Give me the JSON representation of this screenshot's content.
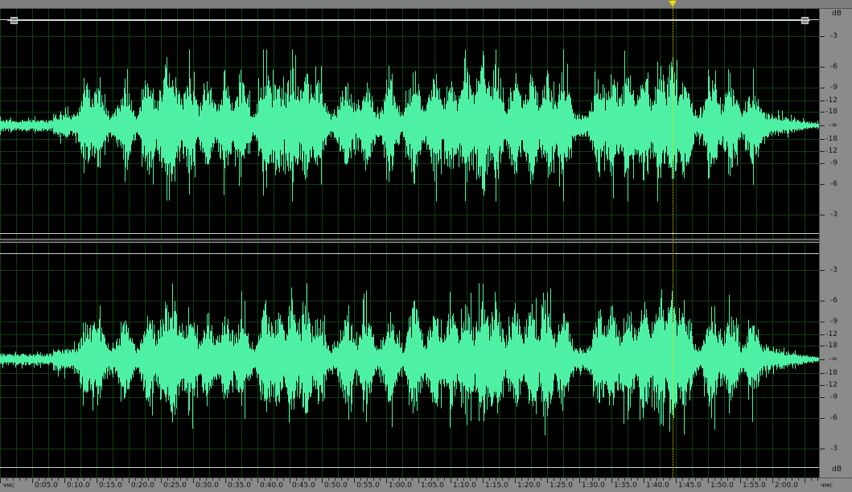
{
  "colors": {
    "waveform": "#4ef0a4",
    "grid": "#0f3d0f",
    "background": "#000000",
    "ruler": "#8b8b8b",
    "playhead": "#e6e600"
  },
  "db_ruler": {
    "unit_top": "dB",
    "unit_bottom": "dB",
    "labels": [
      "-3",
      "-6",
      "-9",
      "-12",
      "-18",
      "-∞",
      "-18",
      "-12",
      "-9",
      "-6",
      "-3"
    ]
  },
  "time_ruler": {
    "start_unit": "чмс",
    "end_unit": "чмс",
    "labels": [
      "0:05.0",
      "0:10.0",
      "0:15.0",
      "0:20.0",
      "0:25.0",
      "0:30.0",
      "0:35.0",
      "0:40.0",
      "0:45.0",
      "0:50.0",
      "0:55.0",
      "1:00.0",
      "1:05.0",
      "1:10.0",
      "1:15.0",
      "1:20.0",
      "1:25.0",
      "1:30.0",
      "1:35.0",
      "1:40.0",
      "1:45.0",
      "1:50.0",
      "1:55.0",
      "2:00.0"
    ],
    "total_seconds": 127.3
  },
  "playhead_seconds": 104.6
}
